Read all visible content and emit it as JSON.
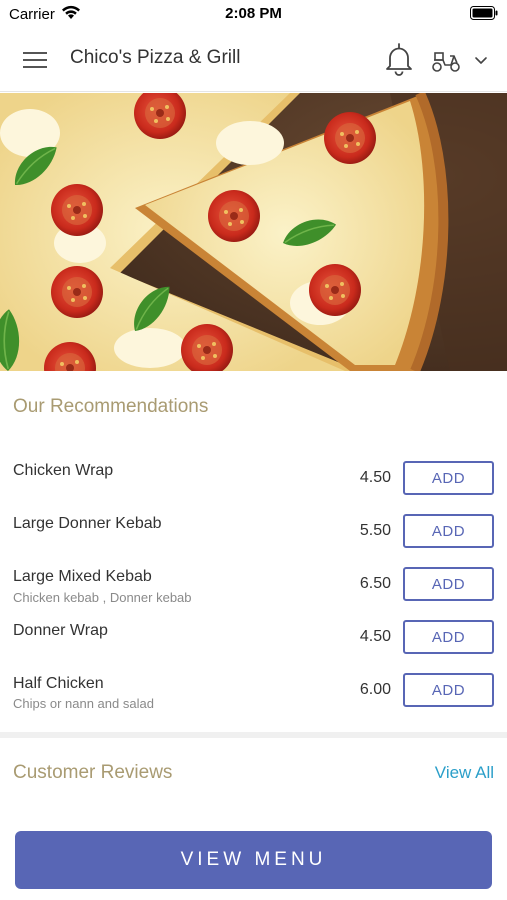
{
  "status_bar": {
    "carrier": "Carrier",
    "time": "2:08 PM"
  },
  "header": {
    "title": "Chico's Pizza & Grill",
    "icons": [
      "menu-icon",
      "bell-icon",
      "delivery-scooter-icon",
      "chevron-down-icon"
    ]
  },
  "hero": {
    "icon": "pizza-photo"
  },
  "recommendations": {
    "title": "Our Recommendations",
    "items": [
      {
        "name": "Chicken Wrap",
        "description": "",
        "price": "4.50",
        "button": "ADD"
      },
      {
        "name": "Large Donner Kebab",
        "description": "",
        "price": "5.50",
        "button": "ADD"
      },
      {
        "name": "Large Mixed Kebab",
        "description": "Chicken kebab , Donner kebab",
        "price": "6.50",
        "button": "ADD"
      },
      {
        "name": "Donner Wrap",
        "description": "",
        "price": "4.50",
        "button": "ADD"
      },
      {
        "name": "Half Chicken",
        "description": "Chips or nann and salad",
        "price": "6.00",
        "button": "ADD"
      }
    ]
  },
  "reviews": {
    "title": "Customer Reviews",
    "view_all": "View All"
  },
  "footer": {
    "view_menu": "VIEW MENU"
  },
  "colors": {
    "accent": "#5866b5",
    "section_title": "#a99b72",
    "link": "#2b9fc9"
  }
}
